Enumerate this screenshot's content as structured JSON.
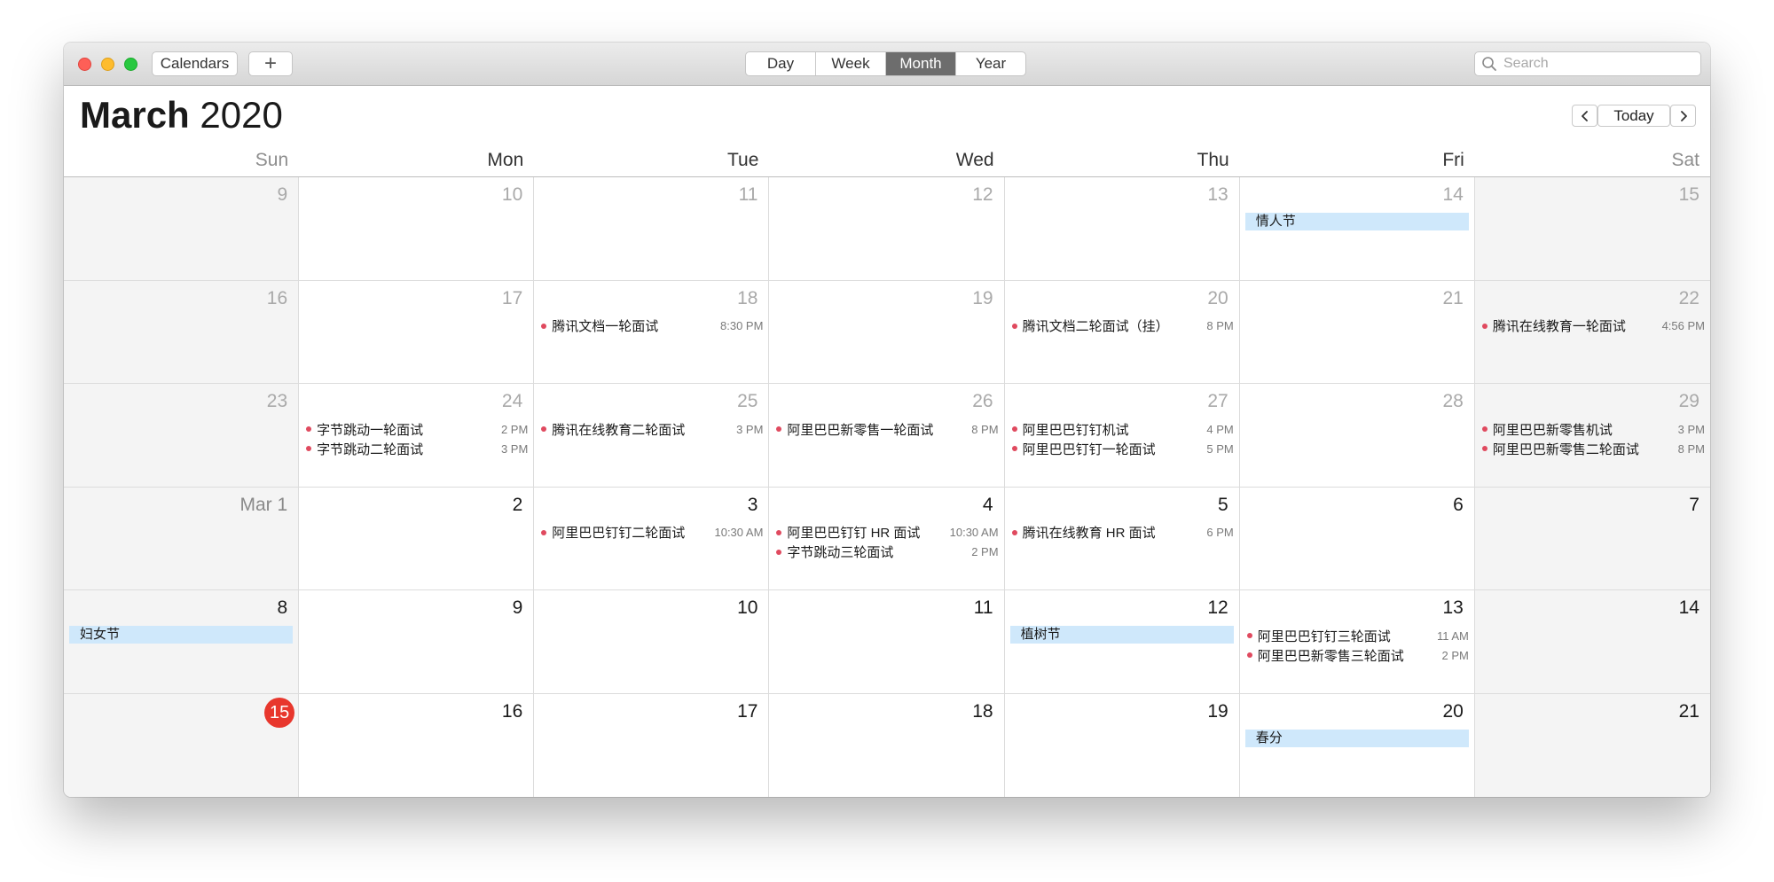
{
  "toolbar": {
    "calendars_label": "Calendars",
    "add_label": "+",
    "views": [
      {
        "label": "Day",
        "active": false
      },
      {
        "label": "Week",
        "active": false
      },
      {
        "label": "Month",
        "active": true
      },
      {
        "label": "Year",
        "active": false
      }
    ],
    "search_placeholder": "Search",
    "search_value": ""
  },
  "header": {
    "month": "March",
    "year": "2020",
    "prev_icon": "chevron-left-icon",
    "today_label": "Today",
    "next_icon": "chevron-right-icon"
  },
  "weekdays": [
    "Sun",
    "Mon",
    "Tue",
    "Wed",
    "Thu",
    "Fri",
    "Sat"
  ],
  "colors": {
    "event_dot": "#e04a5f",
    "allday_bg": "#cfe8fb",
    "today_badge": "#e8372d",
    "weekend_bg": "#f4f4f4"
  },
  "weeks": [
    [
      {
        "label": "9",
        "other": true,
        "allday": [],
        "events": []
      },
      {
        "label": "10",
        "other": true,
        "allday": [],
        "events": []
      },
      {
        "label": "11",
        "other": true,
        "allday": [],
        "events": []
      },
      {
        "label": "12",
        "other": true,
        "allday": [],
        "events": []
      },
      {
        "label": "13",
        "other": true,
        "allday": [],
        "events": []
      },
      {
        "label": "14",
        "other": true,
        "allday": [
          "情人节"
        ],
        "events": []
      },
      {
        "label": "15",
        "other": true,
        "allday": [],
        "events": []
      }
    ],
    [
      {
        "label": "16",
        "other": true,
        "allday": [],
        "events": []
      },
      {
        "label": "17",
        "other": true,
        "allday": [],
        "events": []
      },
      {
        "label": "18",
        "other": true,
        "allday": [],
        "events": [
          {
            "title": "腾讯文档一轮面试",
            "time": "8:30 PM"
          }
        ]
      },
      {
        "label": "19",
        "other": true,
        "allday": [],
        "events": []
      },
      {
        "label": "20",
        "other": true,
        "allday": [],
        "events": [
          {
            "title": "腾讯文档二轮面试（挂）",
            "time": "8 PM"
          }
        ]
      },
      {
        "label": "21",
        "other": true,
        "allday": [],
        "events": []
      },
      {
        "label": "22",
        "other": true,
        "allday": [],
        "events": [
          {
            "title": "腾讯在线教育一轮面试",
            "time": "4:56 PM"
          }
        ]
      }
    ],
    [
      {
        "label": "23",
        "other": true,
        "allday": [],
        "events": []
      },
      {
        "label": "24",
        "other": true,
        "allday": [],
        "events": [
          {
            "title": "字节跳动一轮面试",
            "time": "2 PM"
          },
          {
            "title": "字节跳动二轮面试",
            "time": "3 PM"
          }
        ]
      },
      {
        "label": "25",
        "other": true,
        "allday": [],
        "events": [
          {
            "title": "腾讯在线教育二轮面试",
            "time": "3 PM"
          }
        ]
      },
      {
        "label": "26",
        "other": true,
        "allday": [],
        "events": [
          {
            "title": "阿里巴巴新零售一轮面试",
            "time": "8 PM"
          }
        ]
      },
      {
        "label": "27",
        "other": true,
        "allday": [],
        "events": [
          {
            "title": "阿里巴巴钉钉机试",
            "time": "4 PM"
          },
          {
            "title": "阿里巴巴钉钉一轮面试",
            "time": "5 PM"
          }
        ]
      },
      {
        "label": "28",
        "other": true,
        "allday": [],
        "events": []
      },
      {
        "label": "29",
        "other": true,
        "allday": [],
        "events": [
          {
            "title": "阿里巴巴新零售机试",
            "time": "3 PM"
          },
          {
            "title": "阿里巴巴新零售二轮面试",
            "time": "8 PM"
          }
        ]
      }
    ],
    [
      {
        "label": "Mar 1",
        "other": false,
        "allday": [],
        "events": []
      },
      {
        "label": "2",
        "other": false,
        "allday": [],
        "events": []
      },
      {
        "label": "3",
        "other": false,
        "allday": [],
        "events": [
          {
            "title": "阿里巴巴钉钉二轮面试",
            "time": "10:30 AM"
          }
        ]
      },
      {
        "label": "4",
        "other": false,
        "allday": [],
        "events": [
          {
            "title": "阿里巴巴钉钉 HR 面试",
            "time": "10:30 AM"
          },
          {
            "title": "字节跳动三轮面试",
            "time": "2 PM"
          }
        ]
      },
      {
        "label": "5",
        "other": false,
        "allday": [],
        "events": [
          {
            "title": "腾讯在线教育 HR 面试",
            "time": "6 PM"
          }
        ]
      },
      {
        "label": "6",
        "other": false,
        "allday": [],
        "events": []
      },
      {
        "label": "7",
        "other": false,
        "allday": [],
        "events": []
      }
    ],
    [
      {
        "label": "8",
        "other": false,
        "allday": [
          "妇女节"
        ],
        "events": []
      },
      {
        "label": "9",
        "other": false,
        "allday": [],
        "events": []
      },
      {
        "label": "10",
        "other": false,
        "allday": [],
        "events": []
      },
      {
        "label": "11",
        "other": false,
        "allday": [],
        "events": []
      },
      {
        "label": "12",
        "other": false,
        "allday": [
          "植树节"
        ],
        "events": []
      },
      {
        "label": "13",
        "other": false,
        "allday": [],
        "events": [
          {
            "title": "阿里巴巴钉钉三轮面试",
            "time": "11 AM"
          },
          {
            "title": "阿里巴巴新零售三轮面试",
            "time": "2 PM"
          }
        ]
      },
      {
        "label": "14",
        "other": false,
        "allday": [],
        "events": []
      }
    ],
    [
      {
        "label": "15",
        "other": false,
        "today": true,
        "allday": [],
        "events": []
      },
      {
        "label": "16",
        "other": false,
        "allday": [],
        "events": []
      },
      {
        "label": "17",
        "other": false,
        "allday": [],
        "events": []
      },
      {
        "label": "18",
        "other": false,
        "allday": [],
        "events": []
      },
      {
        "label": "19",
        "other": false,
        "allday": [],
        "events": []
      },
      {
        "label": "20",
        "other": false,
        "allday": [
          "春分"
        ],
        "events": []
      },
      {
        "label": "21",
        "other": false,
        "allday": [],
        "events": []
      }
    ]
  ]
}
